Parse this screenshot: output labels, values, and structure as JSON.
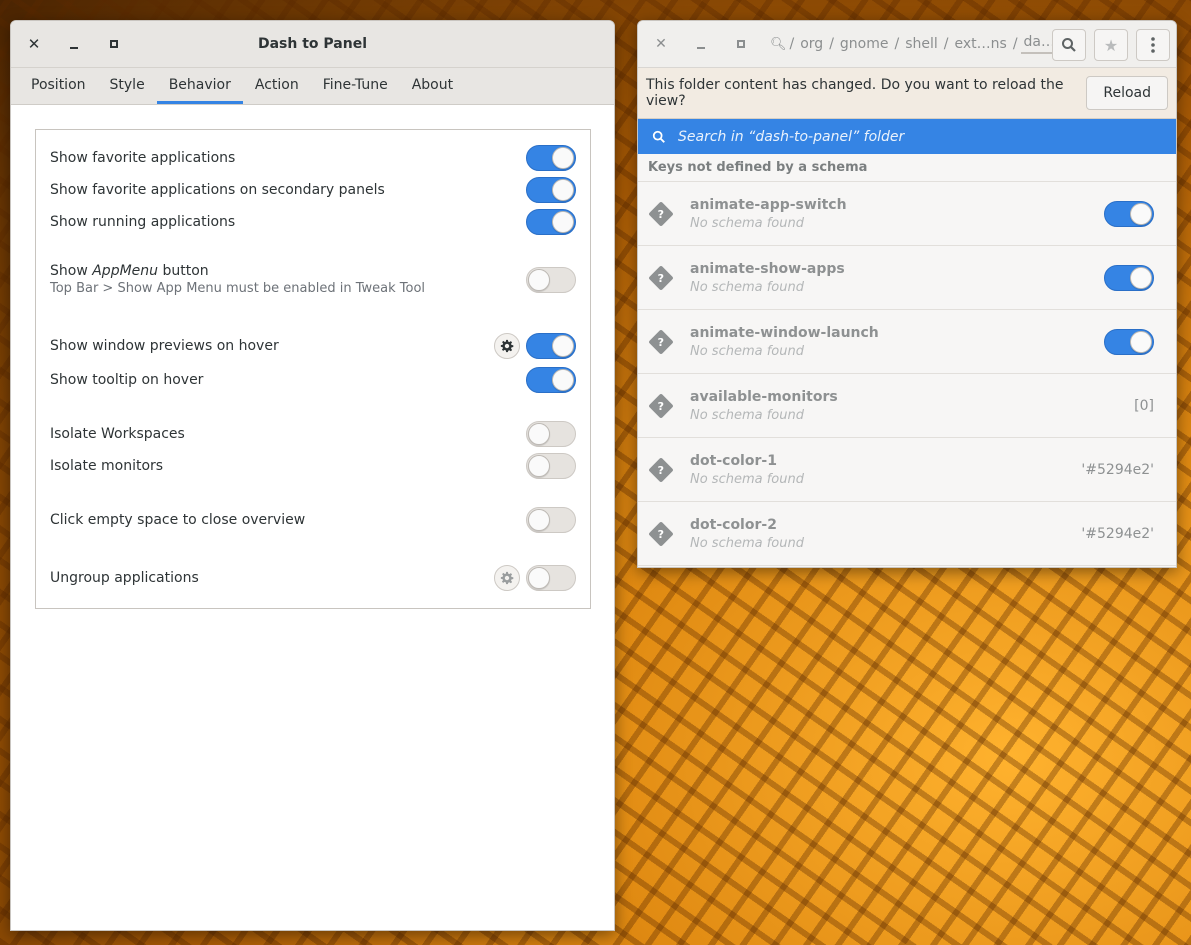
{
  "left_window": {
    "title": "Dash to Panel",
    "tabs": [
      {
        "label": "Position"
      },
      {
        "label": "Style"
      },
      {
        "label": "Behavior"
      },
      {
        "label": "Action"
      },
      {
        "label": "Fine-Tune"
      },
      {
        "label": "About"
      }
    ],
    "active_tab": "Behavior",
    "settings": [
      {
        "label": "Show favorite applications",
        "on": true
      },
      {
        "label": "Show favorite applications on secondary panels",
        "on": true
      },
      {
        "label": "Show running applications",
        "on": true
      },
      {
        "label_pre": "Show ",
        "label_em": "AppMenu",
        "label_post": " button",
        "sub": "Top Bar > Show App Menu must be enabled in Tweak Tool",
        "on": false
      },
      {
        "label": "Show window previews on hover",
        "on": true,
        "gear": true
      },
      {
        "label": "Show tooltip on hover",
        "on": true
      },
      {
        "label": "Isolate Workspaces",
        "on": false
      },
      {
        "label": "Isolate monitors",
        "on": false
      },
      {
        "label": "Click empty space to close overview",
        "on": false
      },
      {
        "label": "Ungroup applications",
        "on": false,
        "gear": true
      }
    ]
  },
  "right_window": {
    "breadcrumbs": [
      "org",
      "gnome",
      "shell",
      "ext…ns",
      "da…el"
    ],
    "infobar": {
      "message": "This folder content has changed. Do you want to reload the view?",
      "button": "Reload"
    },
    "search": {
      "placeholder": "Search in “dash-to-panel” folder"
    },
    "section_title": "Keys not defined by a schema",
    "keys": [
      {
        "name": "animate-app-switch",
        "note": "No schema found",
        "type": "toggle",
        "on": true
      },
      {
        "name": "animate-show-apps",
        "note": "No schema found",
        "type": "toggle",
        "on": true
      },
      {
        "name": "animate-window-launch",
        "note": "No schema found",
        "type": "toggle",
        "on": true
      },
      {
        "name": "available-monitors",
        "note": "No schema found",
        "type": "text",
        "value": "[0]"
      },
      {
        "name": "dot-color-1",
        "note": "No schema found",
        "type": "text",
        "value": "'#5294e2'"
      },
      {
        "name": "dot-color-2",
        "note": "No schema found",
        "type": "text",
        "value": "'#5294e2'"
      }
    ]
  },
  "colors": {
    "accent": "#3584e4",
    "toggle_off": "#e6e3df"
  }
}
